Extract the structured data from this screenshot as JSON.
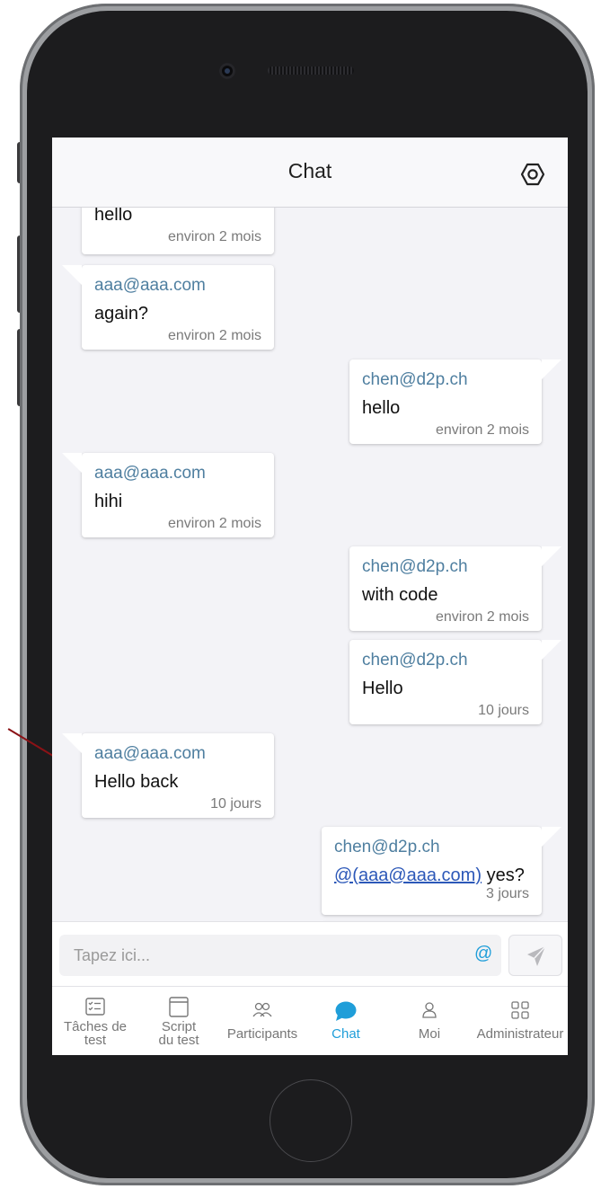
{
  "header": {
    "title": "Chat"
  },
  "messages": [
    {
      "side": "left",
      "sender": "",
      "text": "hello",
      "time": "environ 2 mois"
    },
    {
      "side": "left",
      "sender": "aaa@aaa.com",
      "text": "again?",
      "time": "environ 2 mois"
    },
    {
      "side": "right",
      "sender": "chen@d2p.ch",
      "text": "hello",
      "time": "environ 2 mois"
    },
    {
      "side": "left",
      "sender": "aaa@aaa.com",
      "text": "hihi",
      "time": "environ 2 mois"
    },
    {
      "side": "right",
      "sender": "chen@d2p.ch",
      "text": "with code",
      "time": "environ 2 mois"
    },
    {
      "side": "right",
      "sender": "chen@d2p.ch",
      "text": "Hello",
      "time": "10 jours"
    },
    {
      "side": "left",
      "sender": "aaa@aaa.com",
      "text": "Hello back",
      "time": "10 jours"
    },
    {
      "side": "right",
      "sender": "chen@d2p.ch",
      "mention": "@(aaa@aaa.com)",
      "text": "yes?",
      "time": "3 jours"
    }
  ],
  "input": {
    "placeholder": "Tapez ici...",
    "value": "",
    "mention_button": "@"
  },
  "tabs": [
    {
      "label": "Tâches de test",
      "icon": "task-list-icon",
      "active": false
    },
    {
      "label": "Script du test",
      "icon": "calendar-icon",
      "active": false
    },
    {
      "label": "Participants",
      "icon": "participants-icon",
      "active": false
    },
    {
      "label": "Chat",
      "icon": "chat-bubble-icon",
      "active": true
    },
    {
      "label": "Moi",
      "icon": "user-icon",
      "active": false
    },
    {
      "label": "Administrateur",
      "icon": "grid-icon",
      "active": false
    }
  ],
  "colors": {
    "accent": "#1f9ed9",
    "sender": "#4f7fa0",
    "mention": "#2c58b8",
    "screen_bg": "#f3f3f7"
  }
}
